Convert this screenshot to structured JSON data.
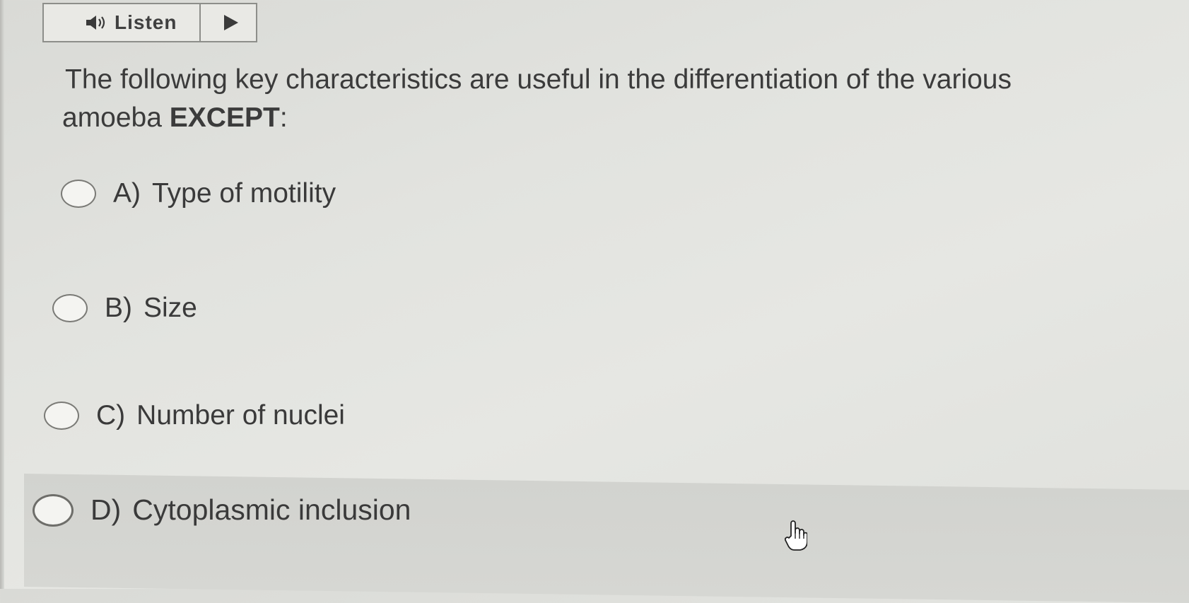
{
  "toolbar": {
    "listen_label": "Listen",
    "speaker_icon": "speaker-icon",
    "play_icon": "play-icon"
  },
  "question": {
    "line1": "The following key characteristics are useful in the differentiation of the various",
    "line2_prefix": "amoeba ",
    "line2_emphasis": "EXCEPT",
    "line2_suffix": ":"
  },
  "options": [
    {
      "letter": "A)",
      "text": "Type of motility",
      "selected": false
    },
    {
      "letter": "B)",
      "text": "Size",
      "selected": false
    },
    {
      "letter": "C)",
      "text": "Number of nuclei",
      "selected": false
    },
    {
      "letter": "D)",
      "text": "Cytoplasmic inclusion",
      "selected": false,
      "hovered": true
    }
  ],
  "cursor": "hand-pointer-icon"
}
